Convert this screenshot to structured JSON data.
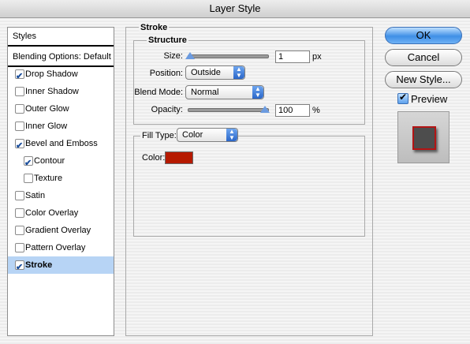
{
  "window": {
    "title": "Layer Style"
  },
  "styles_panel": {
    "header": "Styles",
    "blending_options": "Blending Options: Default",
    "items": [
      {
        "label": "Drop Shadow",
        "checked": true,
        "selected": false,
        "indent": false
      },
      {
        "label": "Inner Shadow",
        "checked": false,
        "selected": false,
        "indent": false
      },
      {
        "label": "Outer Glow",
        "checked": false,
        "selected": false,
        "indent": false
      },
      {
        "label": "Inner Glow",
        "checked": false,
        "selected": false,
        "indent": false
      },
      {
        "label": "Bevel and Emboss",
        "checked": true,
        "selected": false,
        "indent": false
      },
      {
        "label": "Contour",
        "checked": true,
        "selected": false,
        "indent": true
      },
      {
        "label": "Texture",
        "checked": false,
        "selected": false,
        "indent": true
      },
      {
        "label": "Satin",
        "checked": false,
        "selected": false,
        "indent": false
      },
      {
        "label": "Color Overlay",
        "checked": false,
        "selected": false,
        "indent": false
      },
      {
        "label": "Gradient Overlay",
        "checked": false,
        "selected": false,
        "indent": false
      },
      {
        "label": "Pattern Overlay",
        "checked": false,
        "selected": false,
        "indent": false
      },
      {
        "label": "Stroke",
        "checked": true,
        "selected": true,
        "indent": false
      }
    ]
  },
  "stroke": {
    "title": "Stroke",
    "structure": {
      "title": "Structure",
      "size_label": "Size:",
      "size_value": "1",
      "size_unit": "px",
      "size_slider_fraction": 0.0,
      "position_label": "Position:",
      "position_value": "Outside",
      "blend_mode_label": "Blend Mode:",
      "blend_mode_value": "Normal",
      "opacity_label": "Opacity:",
      "opacity_value": "100",
      "opacity_unit": "%",
      "opacity_slider_fraction": 1.0
    },
    "fill": {
      "fill_type_label": "Fill Type:",
      "fill_type_value": "Color",
      "color_label": "Color:",
      "color_value": "#b61a00"
    }
  },
  "buttons": {
    "ok": "OK",
    "cancel": "Cancel",
    "new_style": "New Style..."
  },
  "preview": {
    "label": "Preview",
    "checked": true
  }
}
